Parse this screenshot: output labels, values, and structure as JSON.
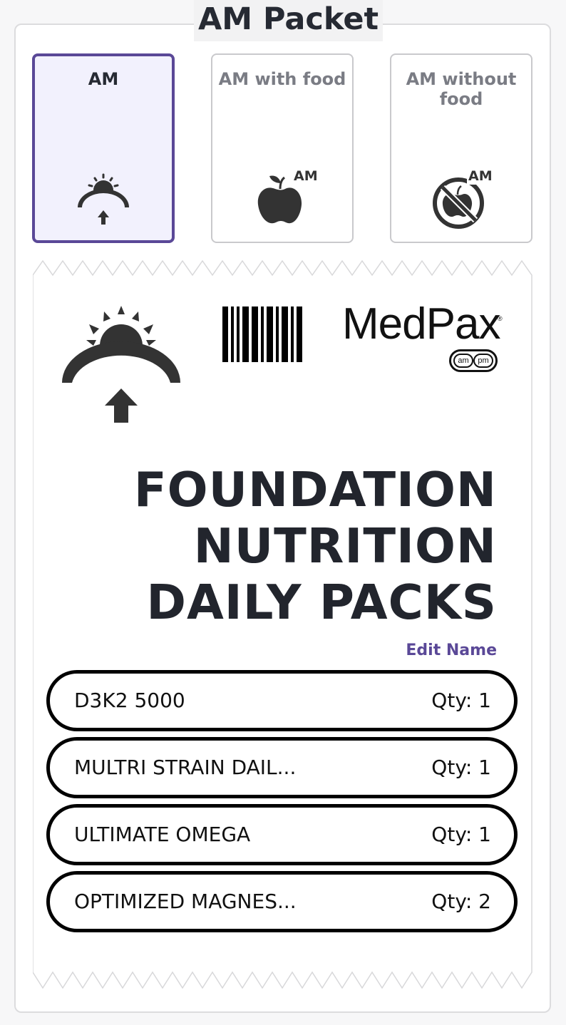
{
  "packet": {
    "title": "AM Packet"
  },
  "options": [
    {
      "label": "AM",
      "selected": true,
      "icon": "sunrise-icon"
    },
    {
      "label": "AM with food",
      "selected": false,
      "icon": "apple-am-icon",
      "badge": "AM"
    },
    {
      "label": "AM without food",
      "selected": false,
      "icon": "no-apple-am-icon",
      "badge": "AM"
    }
  ],
  "pack": {
    "brand_name": "MedPax",
    "brand_reg": "®",
    "pill_left": "am",
    "pill_right": "pm",
    "title_lines": [
      "FOUNDATION",
      "NUTRITION",
      "DAILY PACKS"
    ],
    "edit_label": "Edit Name"
  },
  "items": [
    {
      "name": "D3K2 5000",
      "qty": "Qty: 1"
    },
    {
      "name": "MULTRI STRAIN DAIL...",
      "qty": "Qty: 1"
    },
    {
      "name": "ULTIMATE OMEGA",
      "qty": "Qty: 1"
    },
    {
      "name": "OPTIMIZED MAGNES...",
      "qty": "Qty: 2"
    }
  ],
  "colors": {
    "accent": "#5a4897",
    "selected_bg": "#f2f1fd",
    "text_dark": "#22252d",
    "text_muted": "#7a7c84",
    "icon_dark": "#333333"
  }
}
